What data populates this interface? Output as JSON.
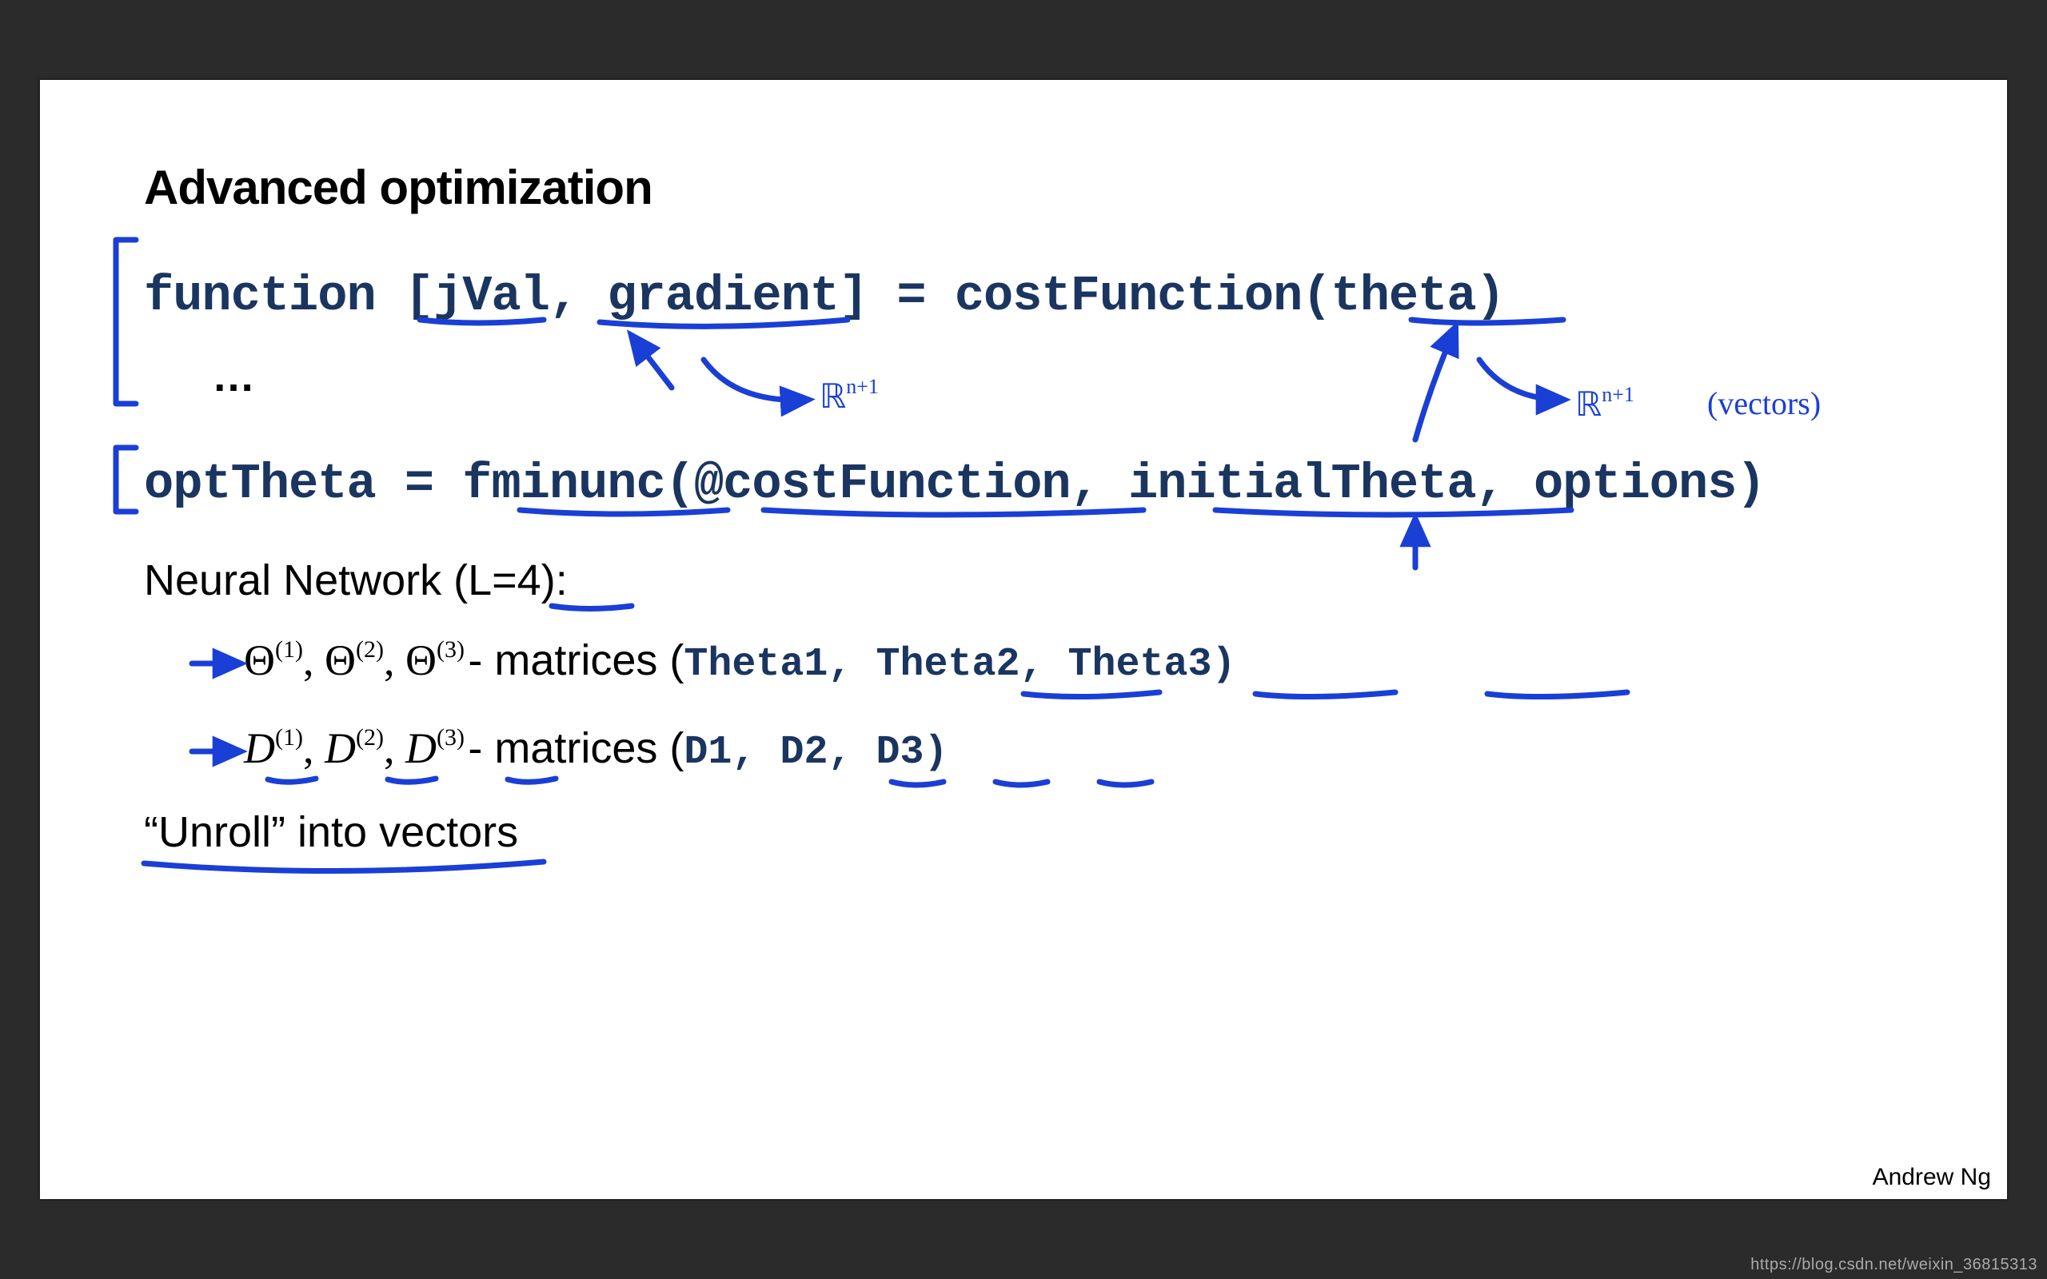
{
  "title": "Advanced optimization",
  "code": {
    "fn_kw": "function ",
    "br_open": "[",
    "jval": "jVal",
    "comma1": ", ",
    "grad": "gradient",
    "br_close": "]",
    "eq": " = costFunction(",
    "theta": "theta",
    "paren_close": ")",
    "ellipsis": "…",
    "opt_lhs": "optTheta = ",
    "fminunc": "fminunc",
    "open2": "(",
    "at_cost": "@costFunction",
    "comma2": ", ",
    "initialTheta": "initialTheta",
    "comma3": ", options)"
  },
  "nn": {
    "header_a": "Neural Network (",
    "L": "L=4",
    "header_b": "):",
    "theta_sym": "Θ",
    "D_sym": "D",
    "sup1": "(1)",
    "sup2": "(2)",
    "sup3": "(3)",
    "sep": ", ",
    "dash_matrices": " - matrices  (",
    "Theta1": "Theta1",
    "Theta2": "Theta2",
    "Theta3": "Theta3",
    "D1": "D1",
    "D2": "D2",
    "D3": "D3",
    "close": ")"
  },
  "unroll": "“Unroll” into vectors",
  "hand": {
    "Rn1_a": "ℝ",
    "Rn1_a_exp": "n+1",
    "Rn1_b": "ℝ",
    "Rn1_b_exp": "n+1",
    "vectors_paren": "(vectors)"
  },
  "author": "Andrew Ng",
  "watermark": "https://blog.csdn.net/weixin_36815313"
}
